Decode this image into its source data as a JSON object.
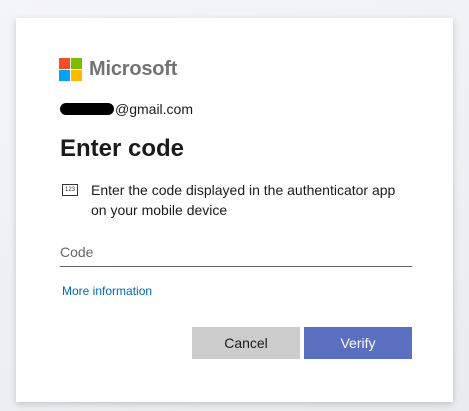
{
  "colors": {
    "logo_red": "#f25022",
    "logo_green": "#7fba00",
    "logo_blue": "#00a4ef",
    "logo_yellow": "#ffb900",
    "primary_button": "#5b6fc0",
    "secondary_button": "#cccccc",
    "link": "#0067b8"
  },
  "brand": {
    "name": "Microsoft"
  },
  "identity": {
    "email_suffix": "@gmail.com"
  },
  "page": {
    "title": "Enter code"
  },
  "instruction": {
    "icon_label": "123",
    "text": "Enter the code displayed in the authenticator app on your mobile device"
  },
  "code_field": {
    "placeholder": "Code",
    "value": ""
  },
  "links": {
    "more_information": "More information"
  },
  "buttons": {
    "cancel": "Cancel",
    "verify": "Verify"
  }
}
